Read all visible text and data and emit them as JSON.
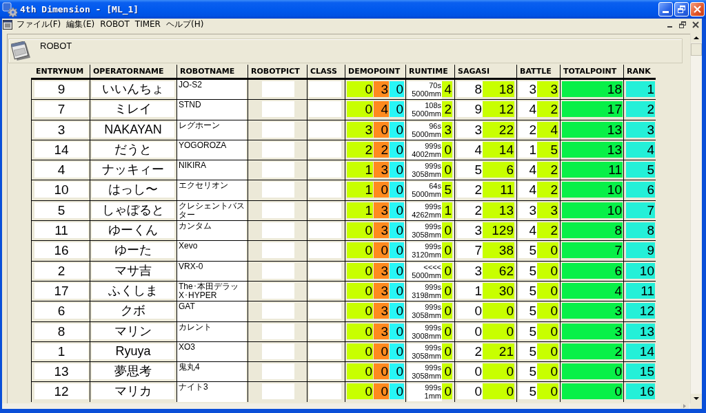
{
  "window": {
    "title": "4th Dimension - [ML_1]"
  },
  "menu_bar": {
    "items": [
      "ファイル(F)",
      "編集(E)",
      "ROBOT",
      "TIMER",
      "ヘルプ(H)"
    ]
  },
  "form": {
    "title": "ROBOT"
  },
  "table": {
    "columns": [
      "ENTRYNUM",
      "OPERATORNAME",
      "ROBOTNAME",
      "ROBOTPICT",
      "CLASS",
      "DEMOPOINT",
      "RUNTIME",
      "SAGASI",
      "BATTLE",
      "TOTALPOINT",
      "RANK"
    ],
    "rows": [
      {
        "entrynum": "9",
        "operatorname": "いいんちょ",
        "robotname": "JO-S2",
        "demopoint": [
          "0",
          "3",
          "0"
        ],
        "runtime": {
          "time": "70s",
          "distance": "5000mm",
          "point": "4"
        },
        "sagasi": [
          "8",
          "18"
        ],
        "battle": [
          "3",
          "3"
        ],
        "totalpoint": "18",
        "rank": "1"
      },
      {
        "entrynum": "7",
        "operatorname": "ミレイ",
        "robotname": "STND",
        "demopoint": [
          "0",
          "4",
          "0"
        ],
        "runtime": {
          "time": "108s",
          "distance": "5000mm",
          "point": "2"
        },
        "sagasi": [
          "9",
          "12"
        ],
        "battle": [
          "4",
          "2"
        ],
        "totalpoint": "17",
        "rank": "2"
      },
      {
        "entrynum": "3",
        "operatorname": "NAKAYAN",
        "robotname": "レグホーン",
        "demopoint": [
          "3",
          "0",
          "0"
        ],
        "runtime": {
          "time": "96s",
          "distance": "5000mm",
          "point": "3"
        },
        "sagasi": [
          "3",
          "22"
        ],
        "battle": [
          "2",
          "4"
        ],
        "totalpoint": "13",
        "rank": "3"
      },
      {
        "entrynum": "14",
        "operatorname": "だうと",
        "robotname": "YOGOROZA",
        "demopoint": [
          "2",
          "2",
          "0"
        ],
        "runtime": {
          "time": "999s",
          "distance": "4002mm",
          "point": "0"
        },
        "sagasi": [
          "4",
          "14"
        ],
        "battle": [
          "1",
          "5"
        ],
        "totalpoint": "13",
        "rank": "4"
      },
      {
        "entrynum": "4",
        "operatorname": "ナッキィー",
        "robotname": "NIKIRA",
        "demopoint": [
          "1",
          "3",
          "0"
        ],
        "runtime": {
          "time": "999s",
          "distance": "3058mm",
          "point": "0"
        },
        "sagasi": [
          "5",
          "6"
        ],
        "battle": [
          "4",
          "2"
        ],
        "totalpoint": "11",
        "rank": "5"
      },
      {
        "entrynum": "10",
        "operatorname": "はっし〜",
        "robotname": "エクセリオン",
        "demopoint": [
          "1",
          "0",
          "0"
        ],
        "runtime": {
          "time": "64s",
          "distance": "5000mm",
          "point": "5"
        },
        "sagasi": [
          "2",
          "11"
        ],
        "battle": [
          "4",
          "2"
        ],
        "totalpoint": "10",
        "rank": "6"
      },
      {
        "entrynum": "5",
        "operatorname": "しゃぼると",
        "robotname": "クレシェントバスター",
        "demopoint": [
          "1",
          "3",
          "0"
        ],
        "runtime": {
          "time": "999s",
          "distance": "4262mm",
          "point": "1"
        },
        "sagasi": [
          "2",
          "13"
        ],
        "battle": [
          "3",
          "3"
        ],
        "totalpoint": "10",
        "rank": "7"
      },
      {
        "entrynum": "11",
        "operatorname": "ゆーくん",
        "robotname": "カンタム",
        "demopoint": [
          "0",
          "3",
          "0"
        ],
        "runtime": {
          "time": "999s",
          "distance": "3058mm",
          "point": "0"
        },
        "sagasi": [
          "3",
          "129"
        ],
        "battle": [
          "4",
          "2"
        ],
        "totalpoint": "8",
        "rank": "8"
      },
      {
        "entrynum": "16",
        "operatorname": "ゆーた",
        "robotname": "Xevo",
        "demopoint": [
          "0",
          "0",
          "0"
        ],
        "runtime": {
          "time": "999s",
          "distance": "3120mm",
          "point": "0"
        },
        "sagasi": [
          "7",
          "38"
        ],
        "battle": [
          "5",
          "0"
        ],
        "totalpoint": "7",
        "rank": "9"
      },
      {
        "entrynum": "2",
        "operatorname": "マサ吉",
        "robotname": "VRX-0",
        "demopoint": [
          "0",
          "3",
          "0"
        ],
        "runtime": {
          "time": "<<<<",
          "distance": "5000mm",
          "point": "0"
        },
        "sagasi": [
          "3",
          "62"
        ],
        "battle": [
          "5",
          "0"
        ],
        "totalpoint": "6",
        "rank": "10"
      },
      {
        "entrynum": "17",
        "operatorname": "ふくしま",
        "robotname": "The･本田デラッX･HYPER",
        "demopoint": [
          "0",
          "3",
          "0"
        ],
        "runtime": {
          "time": "999s",
          "distance": "3198mm",
          "point": "0"
        },
        "sagasi": [
          "1",
          "30"
        ],
        "battle": [
          "5",
          "0"
        ],
        "totalpoint": "4",
        "rank": "11"
      },
      {
        "entrynum": "6",
        "operatorname": "クボ",
        "robotname": "GAT",
        "demopoint": [
          "0",
          "3",
          "0"
        ],
        "runtime": {
          "time": "999s",
          "distance": "3058mm",
          "point": "0"
        },
        "sagasi": [
          "0",
          "0"
        ],
        "battle": [
          "5",
          "0"
        ],
        "totalpoint": "3",
        "rank": "12"
      },
      {
        "entrynum": "8",
        "operatorname": "マリン",
        "robotname": "カレント",
        "demopoint": [
          "0",
          "3",
          "0"
        ],
        "runtime": {
          "time": "999s",
          "distance": "3008mm",
          "point": "0"
        },
        "sagasi": [
          "0",
          "0"
        ],
        "battle": [
          "5",
          "0"
        ],
        "totalpoint": "3",
        "rank": "13"
      },
      {
        "entrynum": "1",
        "operatorname": "Ryuya",
        "robotname": "XO3",
        "demopoint": [
          "0",
          "0",
          "0"
        ],
        "runtime": {
          "time": "999s",
          "distance": "3058mm",
          "point": "0"
        },
        "sagasi": [
          "2",
          "21"
        ],
        "battle": [
          "5",
          "0"
        ],
        "totalpoint": "2",
        "rank": "14"
      },
      {
        "entrynum": "13",
        "operatorname": "夢思考",
        "robotname": "鬼丸4",
        "demopoint": [
          "0",
          "0",
          "0"
        ],
        "runtime": {
          "time": "999s",
          "distance": "3058mm",
          "point": "0"
        },
        "sagasi": [
          "0",
          "0"
        ],
        "battle": [
          "5",
          "0"
        ],
        "totalpoint": "0",
        "rank": "15"
      },
      {
        "entrynum": "12",
        "operatorname": "マリカ",
        "robotname": "ナイト3",
        "demopoint": [
          "0",
          "0",
          "0"
        ],
        "runtime": {
          "time": "999s",
          "distance": "1mm",
          "point": "0"
        },
        "sagasi": [
          "0",
          "0"
        ],
        "battle": [
          "5",
          "0"
        ],
        "totalpoint": "0",
        "rank": "16"
      }
    ]
  }
}
